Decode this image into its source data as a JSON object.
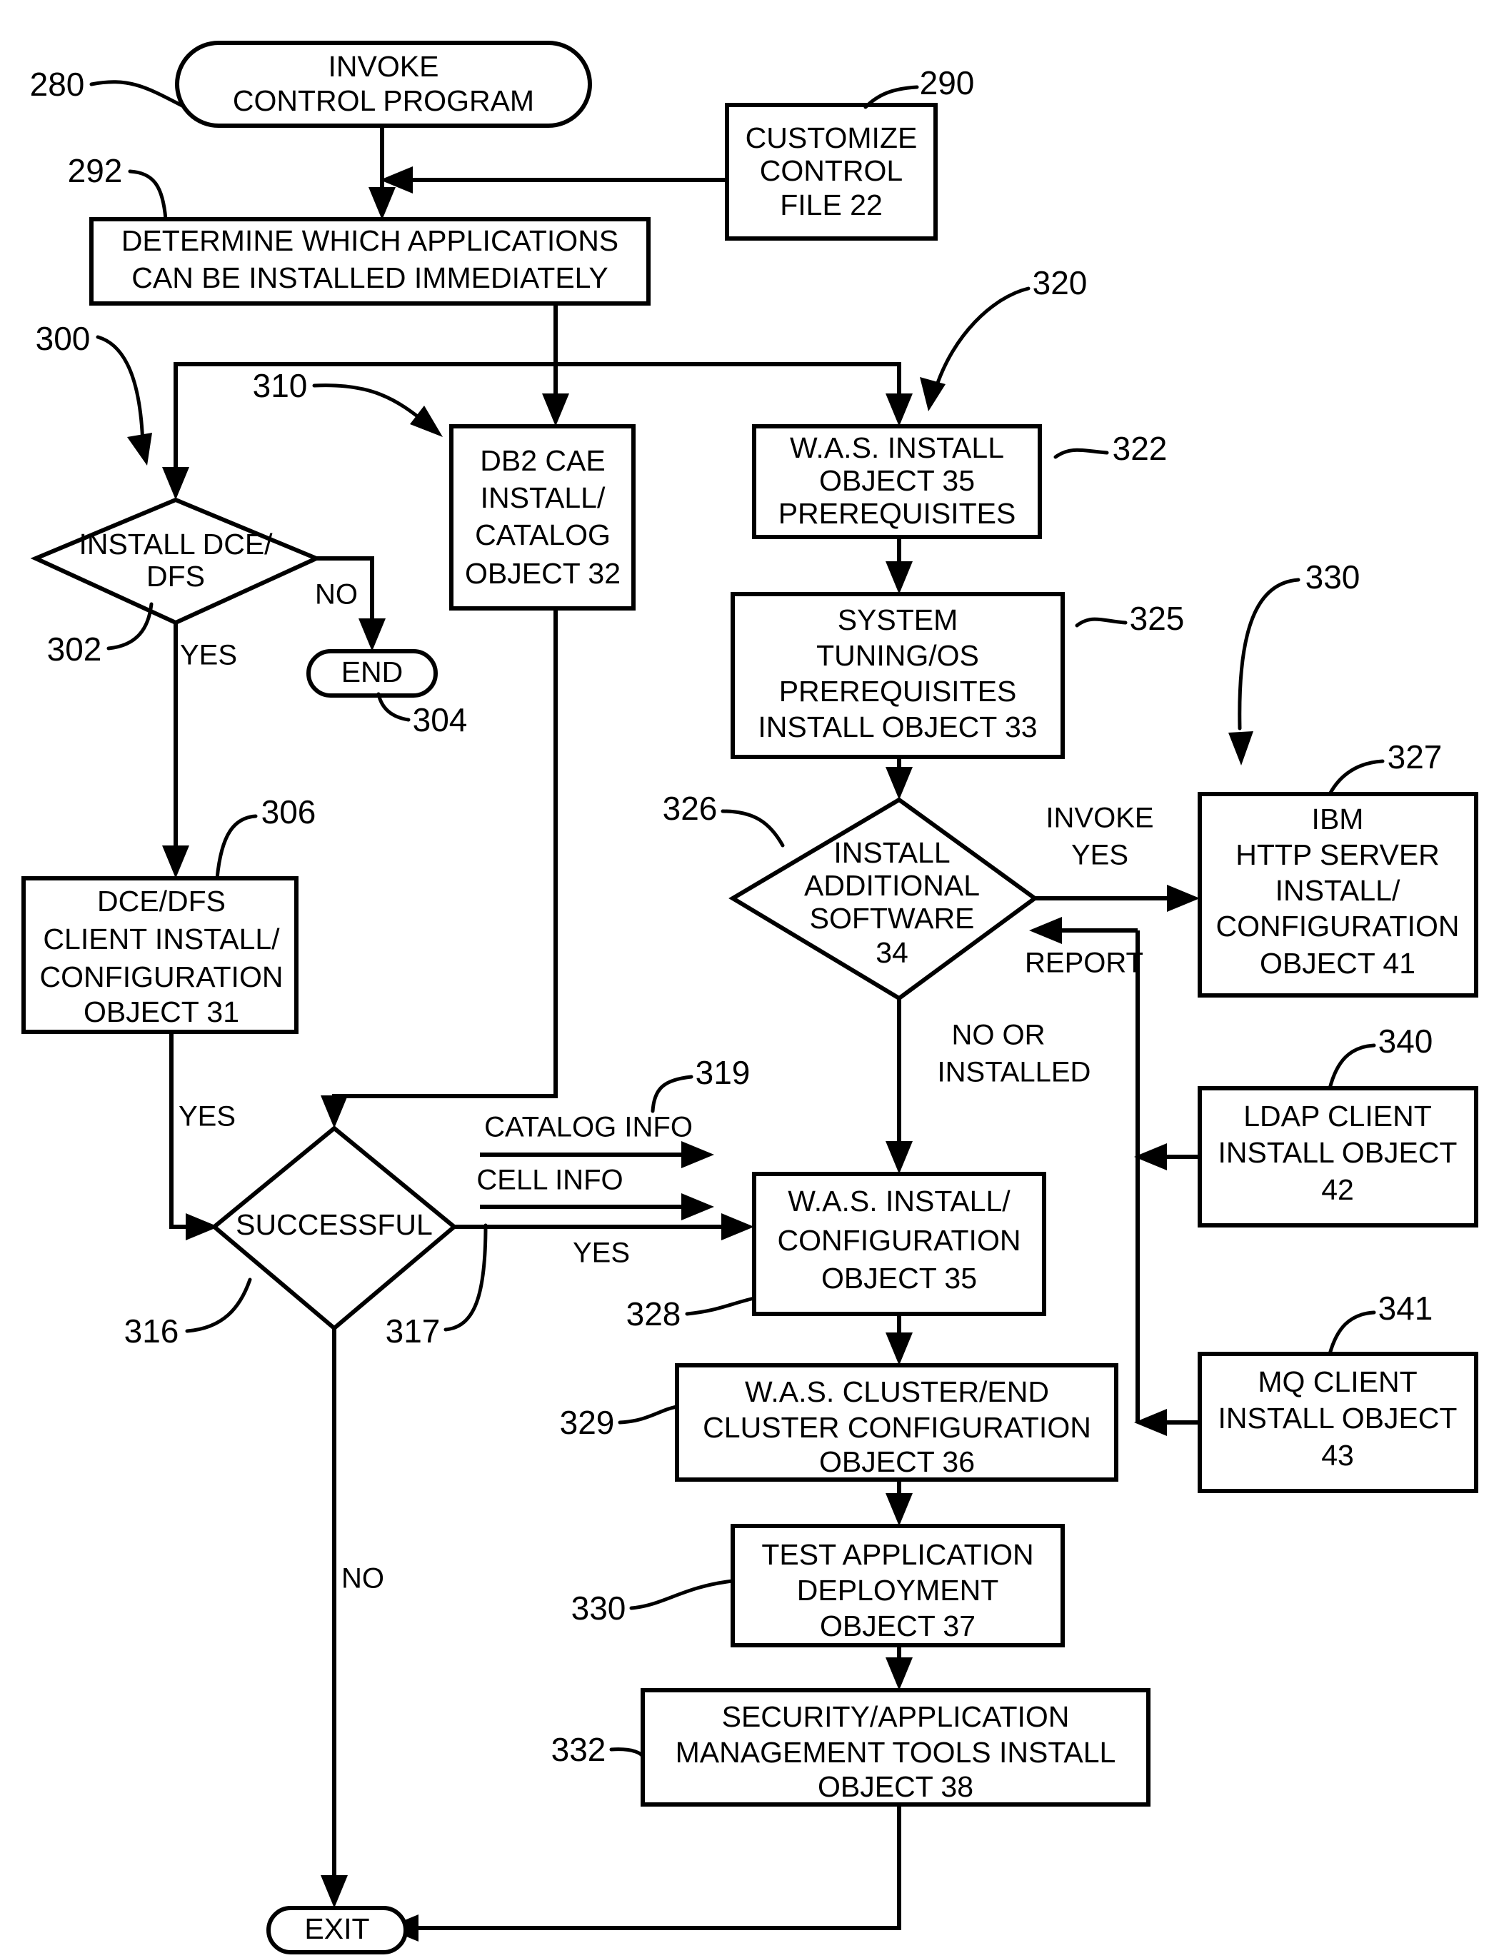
{
  "figure": {
    "type": "patent-flowchart",
    "background": "#ffffff",
    "ink": "#000000"
  },
  "nodes": {
    "invoke_control_program": {
      "label": "INVOKE\nCONTROL PROGRAM",
      "lines": [
        "INVOKE",
        "CONTROL PROGRAM"
      ],
      "ref": "280",
      "shape": "capsule"
    },
    "customize_control_file": {
      "lines": [
        "CUSTOMIZE",
        "CONTROL",
        "FILE 22"
      ],
      "ref": "290",
      "shape": "rect"
    },
    "determine_applications": {
      "lines": [
        "DETERMINE WHICH APPLICATIONS",
        "CAN BE INSTALLED IMMEDIATELY"
      ],
      "ref": "292",
      "shape": "rect"
    },
    "install_dce_dfs": {
      "lines": [
        "INSTALL DCE/",
        "DFS"
      ],
      "ref_in": "300",
      "ref_out": "302",
      "shape": "diamond"
    },
    "end_terminal": {
      "lines": [
        "END"
      ],
      "ref": "304",
      "shape": "capsule"
    },
    "db2_cae": {
      "lines": [
        "DB2 CAE",
        "INSTALL/",
        "CATALOG",
        "OBJECT 32"
      ],
      "ref": "310",
      "shape": "rect"
    },
    "was_install_prereq": {
      "lines": [
        "W.A.S. INSTALL",
        "OBJECT 35",
        "PREREQUISITES"
      ],
      "ref": "322",
      "ref_group": "320",
      "shape": "rect"
    },
    "system_tuning": {
      "lines": [
        "SYSTEM",
        "TUNING/OS",
        "PREREQUISITES",
        "INSTALL OBJECT 33"
      ],
      "ref": "325",
      "shape": "rect"
    },
    "install_additional_software": {
      "lines": [
        "INSTALL",
        "ADDITIONAL",
        "SOFTWARE",
        "34"
      ],
      "ref": "326",
      "shape": "diamond"
    },
    "ibm_http_server": {
      "lines": [
        "IBM",
        "HTTP SERVER",
        "INSTALL/",
        "CONFIGURATION",
        "OBJECT 41"
      ],
      "ref": "327",
      "ref_group": "330",
      "shape": "rect"
    },
    "dce_dfs_client": {
      "lines": [
        "DCE/DFS",
        "CLIENT INSTALL/",
        "CONFIGURATION",
        "OBJECT 31"
      ],
      "ref": "306",
      "shape": "rect"
    },
    "successful": {
      "lines": [
        "SUCCESSFUL"
      ],
      "ref_left": "316",
      "ref_right": "317",
      "shape": "diamond"
    },
    "ldap_client": {
      "lines": [
        "LDAP CLIENT",
        "INSTALL OBJECT",
        "42"
      ],
      "ref": "340",
      "shape": "rect"
    },
    "mq_client": {
      "lines": [
        "MQ CLIENT",
        "INSTALL OBJECT",
        "43"
      ],
      "ref": "341",
      "shape": "rect"
    },
    "was_install_config": {
      "lines": [
        "W.A.S. INSTALL/",
        "CONFIGURATION",
        "OBJECT 35"
      ],
      "ref": "328",
      "shape": "rect"
    },
    "was_cluster": {
      "lines": [
        "W.A.S. CLUSTER/END",
        "CLUSTER CONFIGURATION",
        "OBJECT 36"
      ],
      "ref": "329",
      "shape": "rect"
    },
    "test_application": {
      "lines": [
        "TEST  APPLICATION",
        "DEPLOYMENT",
        "OBJECT 37"
      ],
      "ref": "330",
      "shape": "rect"
    },
    "security_application": {
      "lines": [
        "SECURITY/APPLICATION",
        "MANAGEMENT TOOLS INSTALL",
        "OBJECT 38"
      ],
      "ref": "332",
      "shape": "rect"
    },
    "exit_terminal": {
      "lines": [
        "EXIT"
      ],
      "shape": "capsule"
    }
  },
  "edge_labels": {
    "dce_no": "NO",
    "dce_yes": "YES",
    "client_yes": "YES",
    "successful_yes": "YES",
    "successful_no": "NO",
    "catalog_info": "CATALOG INFO",
    "catalog_info_ref": "319",
    "cell_info": "CELL INFO",
    "invoke": "INVOKE",
    "invoke_yes": "YES",
    "report": "REPORT",
    "no_or_installed_line1": "NO OR",
    "no_or_installed_line2": "INSTALLED"
  },
  "reference_numerals": [
    "280",
    "290",
    "292",
    "300",
    "302",
    "304",
    "310",
    "320",
    "322",
    "325",
    "326",
    "327",
    "330",
    "306",
    "316",
    "317",
    "319",
    "328",
    "329",
    "330",
    "332",
    "340",
    "341"
  ]
}
